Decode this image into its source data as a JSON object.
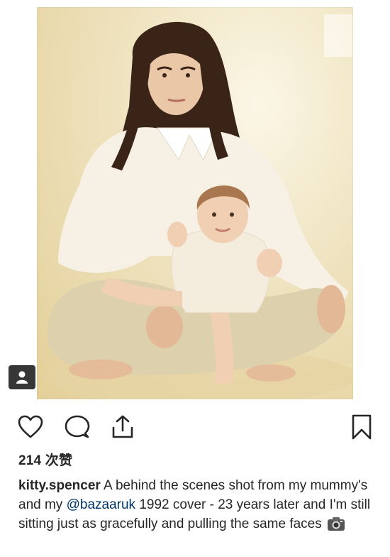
{
  "post": {
    "image_alt": "Mother sitting cross-legged with toddler on her lap, vintage photo",
    "tag_icon": "user-tag-icon"
  },
  "actions": {
    "like_icon": "heart-icon",
    "comment_icon": "comment-icon",
    "share_icon": "share-icon",
    "save_icon": "bookmark-icon"
  },
  "likes": {
    "count_text": "214 次赞"
  },
  "caption": {
    "username": "kitty.spencer",
    "text_before_mention": " A behind the scenes shot from my mummy's and my ",
    "mention": "@bazaaruk",
    "text_after_mention": " 1992 cover - 23 years later and I'm still sitting just as gracefully and pulling the same faces ",
    "emoji": "camera-icon"
  },
  "colors": {
    "text": "#262626",
    "mention": "#003569",
    "icon_stroke": "#262626"
  }
}
